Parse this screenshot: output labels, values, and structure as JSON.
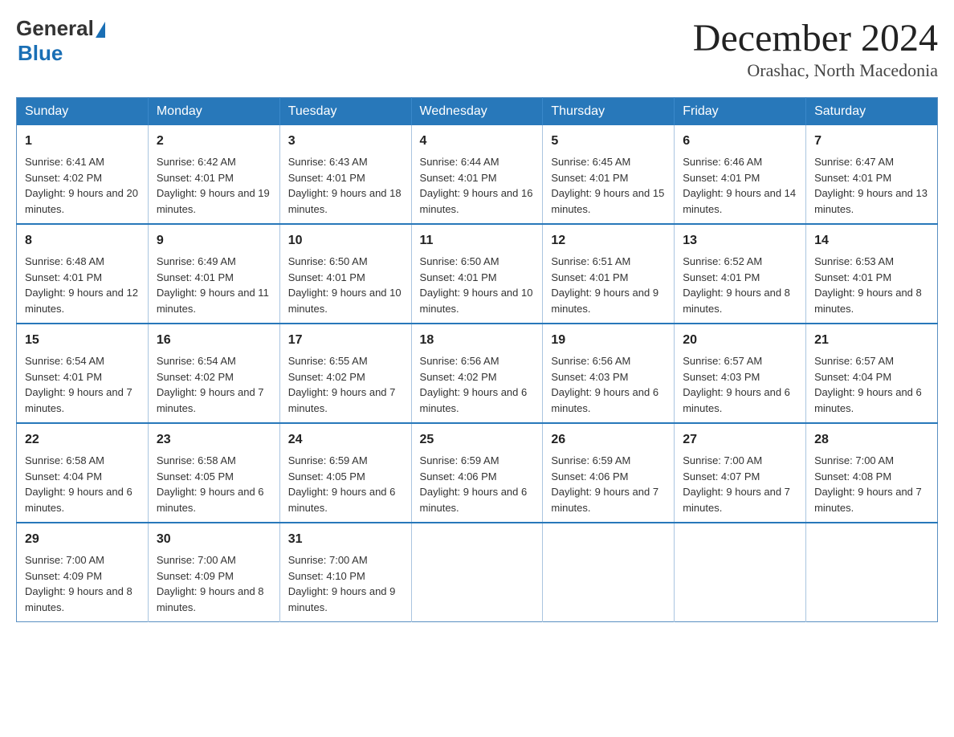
{
  "logo": {
    "general": "General",
    "blue": "Blue"
  },
  "header": {
    "title": "December 2024",
    "subtitle": "Orashac, North Macedonia"
  },
  "weekdays": [
    "Sunday",
    "Monday",
    "Tuesday",
    "Wednesday",
    "Thursday",
    "Friday",
    "Saturday"
  ],
  "weeks": [
    [
      {
        "day": "1",
        "sunrise": "6:41 AM",
        "sunset": "4:02 PM",
        "daylight": "9 hours and 20 minutes."
      },
      {
        "day": "2",
        "sunrise": "6:42 AM",
        "sunset": "4:01 PM",
        "daylight": "9 hours and 19 minutes."
      },
      {
        "day": "3",
        "sunrise": "6:43 AM",
        "sunset": "4:01 PM",
        "daylight": "9 hours and 18 minutes."
      },
      {
        "day": "4",
        "sunrise": "6:44 AM",
        "sunset": "4:01 PM",
        "daylight": "9 hours and 16 minutes."
      },
      {
        "day": "5",
        "sunrise": "6:45 AM",
        "sunset": "4:01 PM",
        "daylight": "9 hours and 15 minutes."
      },
      {
        "day": "6",
        "sunrise": "6:46 AM",
        "sunset": "4:01 PM",
        "daylight": "9 hours and 14 minutes."
      },
      {
        "day": "7",
        "sunrise": "6:47 AM",
        "sunset": "4:01 PM",
        "daylight": "9 hours and 13 minutes."
      }
    ],
    [
      {
        "day": "8",
        "sunrise": "6:48 AM",
        "sunset": "4:01 PM",
        "daylight": "9 hours and 12 minutes."
      },
      {
        "day": "9",
        "sunrise": "6:49 AM",
        "sunset": "4:01 PM",
        "daylight": "9 hours and 11 minutes."
      },
      {
        "day": "10",
        "sunrise": "6:50 AM",
        "sunset": "4:01 PM",
        "daylight": "9 hours and 10 minutes."
      },
      {
        "day": "11",
        "sunrise": "6:50 AM",
        "sunset": "4:01 PM",
        "daylight": "9 hours and 10 minutes."
      },
      {
        "day": "12",
        "sunrise": "6:51 AM",
        "sunset": "4:01 PM",
        "daylight": "9 hours and 9 minutes."
      },
      {
        "day": "13",
        "sunrise": "6:52 AM",
        "sunset": "4:01 PM",
        "daylight": "9 hours and 8 minutes."
      },
      {
        "day": "14",
        "sunrise": "6:53 AM",
        "sunset": "4:01 PM",
        "daylight": "9 hours and 8 minutes."
      }
    ],
    [
      {
        "day": "15",
        "sunrise": "6:54 AM",
        "sunset": "4:01 PM",
        "daylight": "9 hours and 7 minutes."
      },
      {
        "day": "16",
        "sunrise": "6:54 AM",
        "sunset": "4:02 PM",
        "daylight": "9 hours and 7 minutes."
      },
      {
        "day": "17",
        "sunrise": "6:55 AM",
        "sunset": "4:02 PM",
        "daylight": "9 hours and 7 minutes."
      },
      {
        "day": "18",
        "sunrise": "6:56 AM",
        "sunset": "4:02 PM",
        "daylight": "9 hours and 6 minutes."
      },
      {
        "day": "19",
        "sunrise": "6:56 AM",
        "sunset": "4:03 PM",
        "daylight": "9 hours and 6 minutes."
      },
      {
        "day": "20",
        "sunrise": "6:57 AM",
        "sunset": "4:03 PM",
        "daylight": "9 hours and 6 minutes."
      },
      {
        "day": "21",
        "sunrise": "6:57 AM",
        "sunset": "4:04 PM",
        "daylight": "9 hours and 6 minutes."
      }
    ],
    [
      {
        "day": "22",
        "sunrise": "6:58 AM",
        "sunset": "4:04 PM",
        "daylight": "9 hours and 6 minutes."
      },
      {
        "day": "23",
        "sunrise": "6:58 AM",
        "sunset": "4:05 PM",
        "daylight": "9 hours and 6 minutes."
      },
      {
        "day": "24",
        "sunrise": "6:59 AM",
        "sunset": "4:05 PM",
        "daylight": "9 hours and 6 minutes."
      },
      {
        "day": "25",
        "sunrise": "6:59 AM",
        "sunset": "4:06 PM",
        "daylight": "9 hours and 6 minutes."
      },
      {
        "day": "26",
        "sunrise": "6:59 AM",
        "sunset": "4:06 PM",
        "daylight": "9 hours and 7 minutes."
      },
      {
        "day": "27",
        "sunrise": "7:00 AM",
        "sunset": "4:07 PM",
        "daylight": "9 hours and 7 minutes."
      },
      {
        "day": "28",
        "sunrise": "7:00 AM",
        "sunset": "4:08 PM",
        "daylight": "9 hours and 7 minutes."
      }
    ],
    [
      {
        "day": "29",
        "sunrise": "7:00 AM",
        "sunset": "4:09 PM",
        "daylight": "9 hours and 8 minutes."
      },
      {
        "day": "30",
        "sunrise": "7:00 AM",
        "sunset": "4:09 PM",
        "daylight": "9 hours and 8 minutes."
      },
      {
        "day": "31",
        "sunrise": "7:00 AM",
        "sunset": "4:10 PM",
        "daylight": "9 hours and 9 minutes."
      },
      null,
      null,
      null,
      null
    ]
  ],
  "labels": {
    "sunrise": "Sunrise:",
    "sunset": "Sunset:",
    "daylight": "Daylight:"
  }
}
